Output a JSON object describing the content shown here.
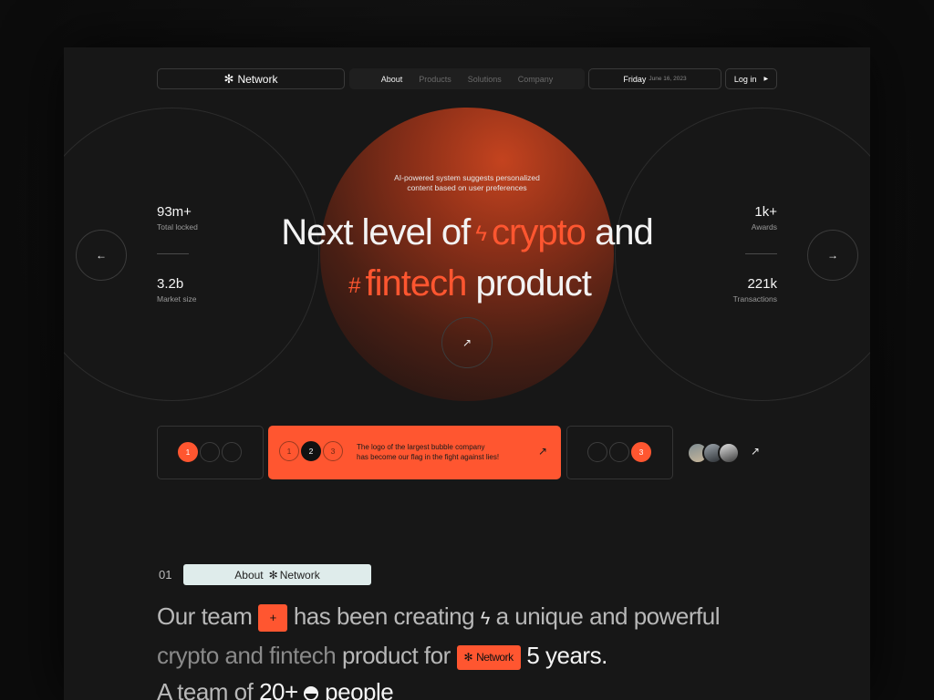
{
  "header": {
    "logo_icon": "asterisk-icon",
    "logo_text": "Network",
    "nav": [
      "About",
      "Products",
      "Solutions",
      "Company"
    ],
    "active_nav": "About",
    "date_day": "Friday",
    "date_full": "June 16, 2023",
    "login_label": "Log in"
  },
  "hero": {
    "tagline_line1": "AI-powered system suggests personalized",
    "tagline_line2": "content based on user preferences",
    "headline": {
      "part1": "Next level of",
      "highlight1": "crypto",
      "part2": "and",
      "highlight2": "fintech",
      "part3": "product"
    },
    "left_stats": [
      {
        "value": "93m+",
        "label": "Total locked"
      },
      {
        "value": "3.2b",
        "label": "Market size"
      }
    ],
    "right_stats": [
      {
        "value": "1k+",
        "label": "Awards"
      },
      {
        "value": "221k",
        "label": "Transactions"
      }
    ],
    "prev_icon": "arrow-left-icon",
    "next_icon": "arrow-right-icon",
    "cta_icon": "arrow-up-right-icon"
  },
  "slider": {
    "card1_dots": [
      "1",
      "",
      ""
    ],
    "card2_dots": [
      "1",
      "2",
      "3"
    ],
    "card2_text_line1": "The logo of the largest bubble company",
    "card2_text_line2": "has become our flag in the fight against lies!",
    "card3_dots": [
      "",
      "",
      "3"
    ]
  },
  "about": {
    "number": "01",
    "pill_label": "About",
    "pill_brand": "Network",
    "line1_a": "Our team",
    "line1_b": "has been creating",
    "line1_c": "a unique and powerful",
    "line2_a": "crypto and fintech",
    "line2_b": "product for",
    "line2_brand": "Network",
    "line2_c": "5 years.",
    "line3_a": "A team of",
    "line3_b": "20+",
    "line3_c": "people"
  },
  "colors": {
    "accent": "#ff5630",
    "background": "#171717",
    "pill": "#dfeceb"
  }
}
